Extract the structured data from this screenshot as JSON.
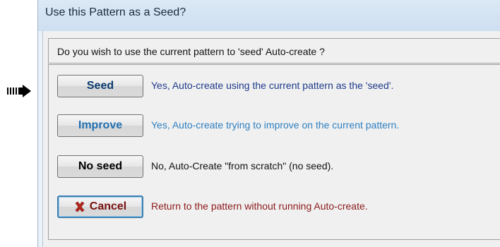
{
  "window": {
    "title": "Use this Pattern as a Seed?"
  },
  "question": "Do you wish to use the current pattern to 'seed' Auto-create ?",
  "options": [
    {
      "button_label": "Seed",
      "description": "Yes, Auto-create using the current pattern as the 'seed'.",
      "button_color": "#0b3a6e",
      "desc_color": "#1e3a8a"
    },
    {
      "button_label": "Improve",
      "description": "Yes, Auto-create trying to improve on the current pattern.",
      "button_color": "#1f6fb0",
      "desc_color": "#2f7fc0"
    },
    {
      "button_label": "No seed",
      "description": "No, Auto-Create \"from scratch\" (no seed).",
      "button_color": "#000000",
      "desc_color": "#111111"
    },
    {
      "button_label": "Cancel",
      "description": "Return to the pattern without running Auto-create.",
      "button_color": "#7a1010",
      "desc_color": "#8b1a1a",
      "icon": "x-close-icon"
    }
  ],
  "pointer_icon": "arrow-right-icon"
}
